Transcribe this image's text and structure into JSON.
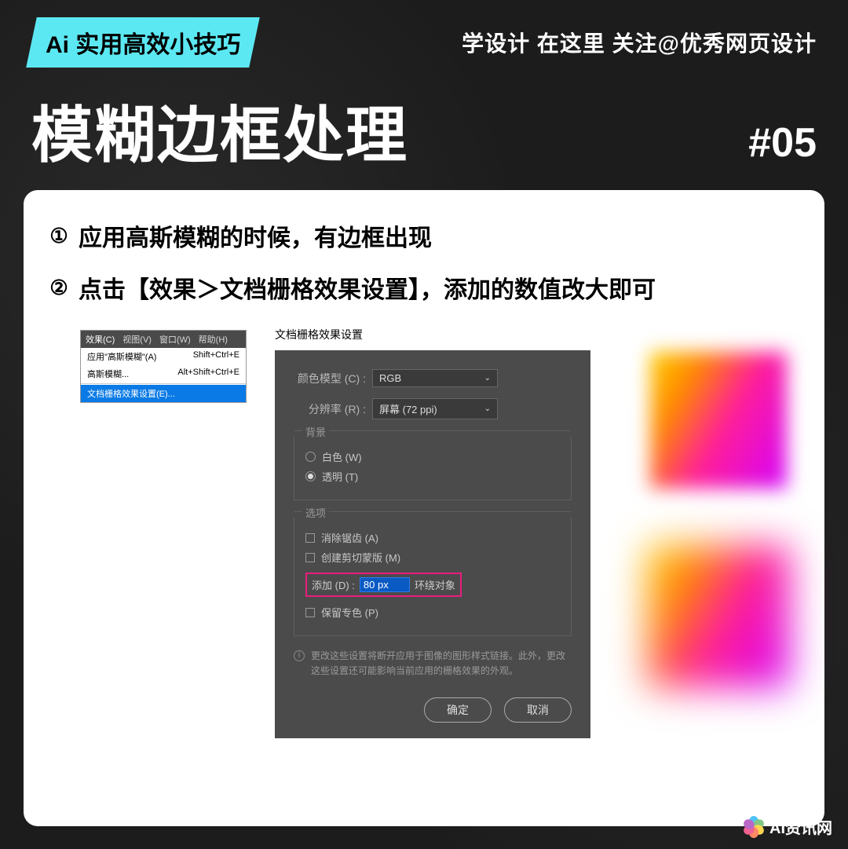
{
  "header": {
    "badge": "Ai 实用高效小技巧",
    "right_text": "学设计  在这里   关注@优秀网页设计"
  },
  "title": "模糊边框处理",
  "tip_number": "#05",
  "steps": [
    "应用高斯模糊的时候，有边框出现",
    "点击【效果＞文档栅格效果设置】，添加的数值改大即可"
  ],
  "menu": {
    "bar": [
      "效果(C)",
      "视图(V)",
      "窗口(W)",
      "帮助(H)"
    ],
    "items": [
      {
        "label": "应用\"高斯模糊\"(A)",
        "shortcut": "Shift+Ctrl+E"
      },
      {
        "label": "高斯模糊...",
        "shortcut": "Alt+Shift+Ctrl+E"
      }
    ],
    "selected": {
      "label": "文档栅格效果设置(E)...",
      "shortcut": ""
    }
  },
  "dialog": {
    "title": "文档栅格效果设置",
    "color_model_label": "颜色模型 (C) :",
    "color_model_value": "RGB",
    "resolution_label": "分辨率 (R) :",
    "resolution_value": "屏幕 (72 ppi)",
    "background_section": "背景",
    "bg_white": "白色 (W)",
    "bg_transparent": "透明 (T)",
    "options_section": "选项",
    "opt_antialias": "消除锯齿 (A)",
    "opt_clipmask": "创建剪切蒙版 (M)",
    "add_label": "添加 (D) :",
    "add_value": "80 px",
    "add_suffix": "环绕对象",
    "opt_spotcolor": "保留专色 (P)",
    "info_text": "更改这些设置将断开应用于图像的图形样式链接。此外，更改这些设置还可能影响当前应用的栅格效果的外观。",
    "ok_button": "确定",
    "cancel_button": "取消"
  },
  "watermark": "AI资讯网",
  "colors": {
    "badge_bg": "#5ce8f2",
    "highlight": "#ea1c7e",
    "menu_select": "#0a7ae6"
  }
}
